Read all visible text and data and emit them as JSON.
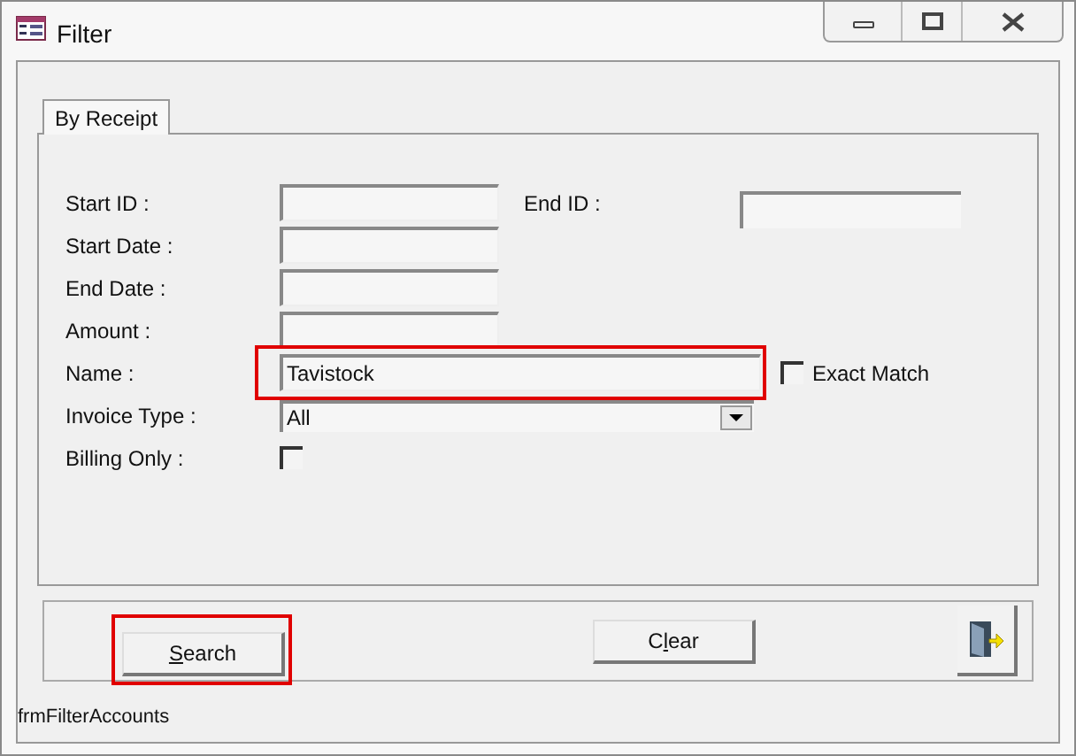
{
  "window": {
    "title": "Filter"
  },
  "tabs": [
    {
      "label": "By Receipt",
      "selected": true
    }
  ],
  "fields": [
    {
      "label": "Start ID :",
      "kind": "text",
      "side": {
        "label": "End ID :"
      }
    },
    {
      "label": "Start Date :",
      "kind": "text"
    },
    {
      "label": "End Date :",
      "kind": "text"
    },
    {
      "label": "Amount :",
      "kind": "text"
    },
    {
      "label": "Name :",
      "kind": "text",
      "value": "Tavistock",
      "highlighted": true,
      "exact_match": {
        "label": "Exact Match",
        "checked": false
      }
    },
    {
      "label": "Invoice Type :",
      "kind": "dropdown",
      "value": "All"
    },
    {
      "label": "Billing Only :",
      "kind": "checkbox",
      "checked": false
    }
  ],
  "buttons": [
    {
      "label_parts": [
        {
          "text": "S",
          "underlined": true
        },
        {
          "text": "earch",
          "underlined": false
        }
      ],
      "highlighted": true
    },
    {
      "label_parts": [
        {
          "text": "C",
          "underlined": false
        },
        {
          "text": "l",
          "underlined": true
        },
        {
          "text": "ear",
          "underlined": false
        }
      ],
      "highlighted": false
    }
  ],
  "form_name": "frmFilterAccounts"
}
